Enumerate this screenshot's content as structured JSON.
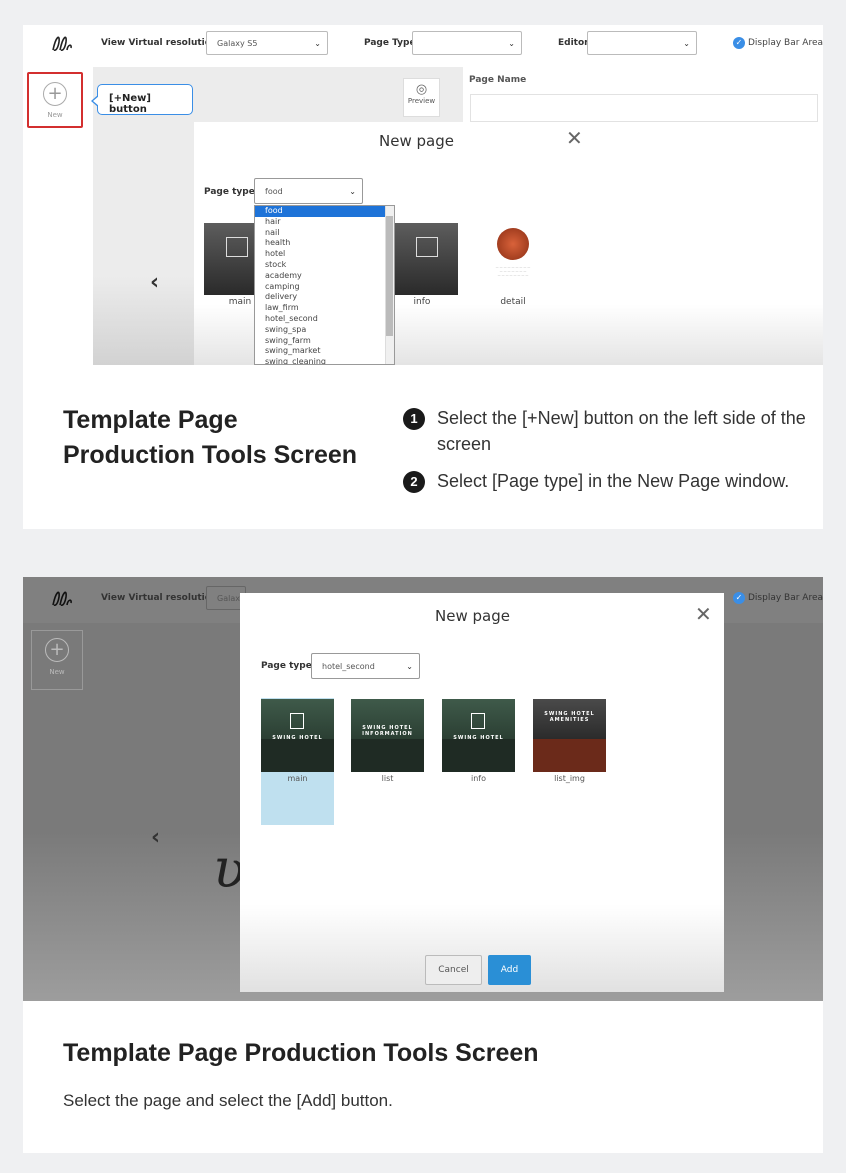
{
  "panel1": {
    "topbar": {
      "view_label": "View Virtual resolution",
      "view_value": "Galaxy S5",
      "page_type_label": "Page Type",
      "page_type_value": "",
      "editor_label": "Editor",
      "editor_value": "",
      "display_bar": "Display Bar Area"
    },
    "new_label": "New",
    "callout": "[+New] button",
    "preview": "Preview",
    "page_name": "Page Name",
    "modal": {
      "title": "New page",
      "page_type_label": "Page type",
      "page_type_value": "food",
      "options": [
        "food",
        "hair",
        "nail",
        "health",
        "hotel",
        "stock",
        "academy",
        "camping",
        "delivery",
        "law_firm",
        "hotel_second",
        "swing_spa",
        "swing_farm",
        "swing_market",
        "swing_cleaning"
      ],
      "thumbs": [
        "main",
        "info",
        "detail"
      ]
    }
  },
  "desc1": {
    "title_line1": "Template Page",
    "title_line2": "Production Tools Screen",
    "steps": [
      {
        "num": "1",
        "text": "Select the [+New] button on the left side of the screen"
      },
      {
        "num": "2",
        "text": "Select [Page type] in the New Page window."
      }
    ]
  },
  "panel2": {
    "topbar": {
      "view_label": "View Virtual resolution",
      "view_value": "Galaxy",
      "display_bar": "Display Bar Area"
    },
    "new_label": "New",
    "modal": {
      "title": "New page",
      "page_type_label": "Page type",
      "page_type_value": "hotel_second",
      "cards": [
        {
          "caption": "main",
          "title": "SWING HOTEL"
        },
        {
          "caption": "list",
          "title": "SWING HOTEL INFORMATION"
        },
        {
          "caption": "info",
          "title": "SWING HOTEL"
        },
        {
          "caption": "list_img",
          "title": "SWING HOTEL AMENITIES"
        }
      ],
      "cancel": "Cancel",
      "add": "Add"
    }
  },
  "desc2": {
    "title": "Template Page Production Tools Screen",
    "text": "Select the page and select the [Add] button."
  }
}
